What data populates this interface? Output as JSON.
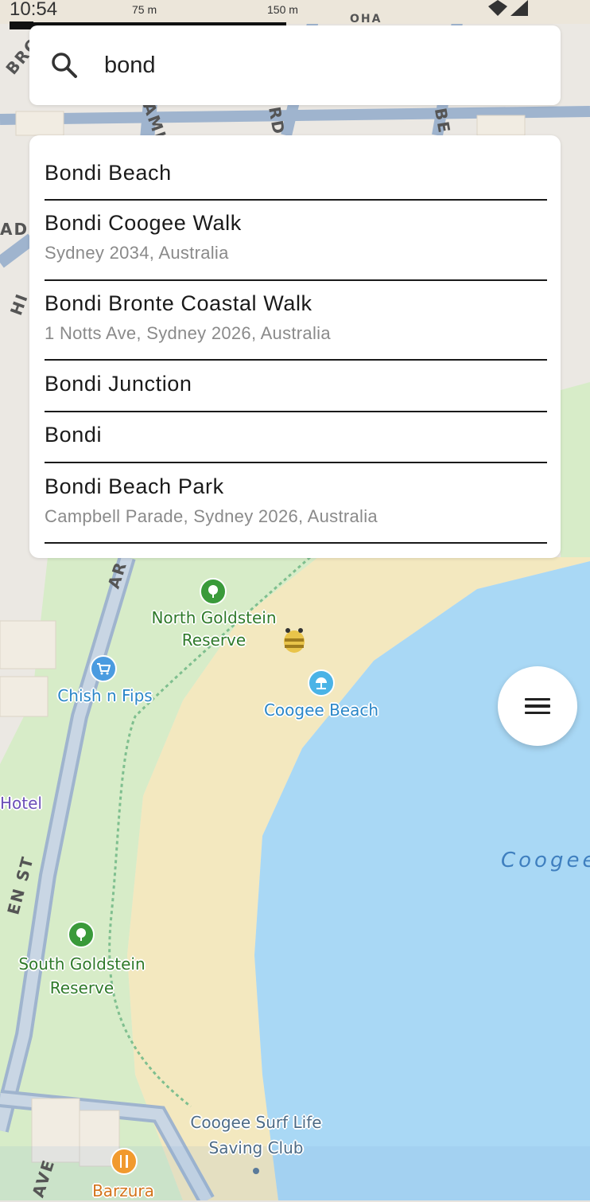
{
  "status_bar": {
    "time": "10:54"
  },
  "map": {
    "scale": {
      "label_1": "75 m",
      "label_2": "150 m"
    },
    "pois": {
      "north_goldstein": "North Goldstein\nReserve",
      "chish_n_fips": "Chish n Fips",
      "coogee_beach": "Coogee Beach",
      "hotel": "Hotel",
      "south_goldstein": "South Goldstein\nReserve",
      "surf_club": "Coogee Surf Life\nSaving Club",
      "barzura": "Barzura"
    },
    "water_label": "Coogee",
    "street_labels": [
      "BRO",
      "ADI",
      "HI",
      "AMI",
      "RD",
      "BE",
      "AR",
      "EN ST",
      "AVE",
      "OHA"
    ],
    "colors": {
      "water": "#a9d8f5",
      "sand": "#f3e8bf",
      "park": "#d7ecc8",
      "land": "#ebe8e3",
      "road": "#9fb4ce"
    }
  },
  "search": {
    "value": "bond",
    "icon": "search-icon"
  },
  "results": [
    {
      "title": "Bondi Beach",
      "subtitle": ""
    },
    {
      "title": "Bondi Coogee Walk",
      "subtitle": "Sydney 2034, Australia"
    },
    {
      "title": "Bondi Bronte Coastal Walk",
      "subtitle": "1 Notts Ave, Sydney 2026, Australia"
    },
    {
      "title": "Bondi Junction",
      "subtitle": ""
    },
    {
      "title": "Bondi",
      "subtitle": ""
    },
    {
      "title": "Bondi Beach Park",
      "subtitle": "Campbell Parade, Sydney 2026, Australia"
    }
  ],
  "fab": {
    "icon": "menu-icon"
  }
}
